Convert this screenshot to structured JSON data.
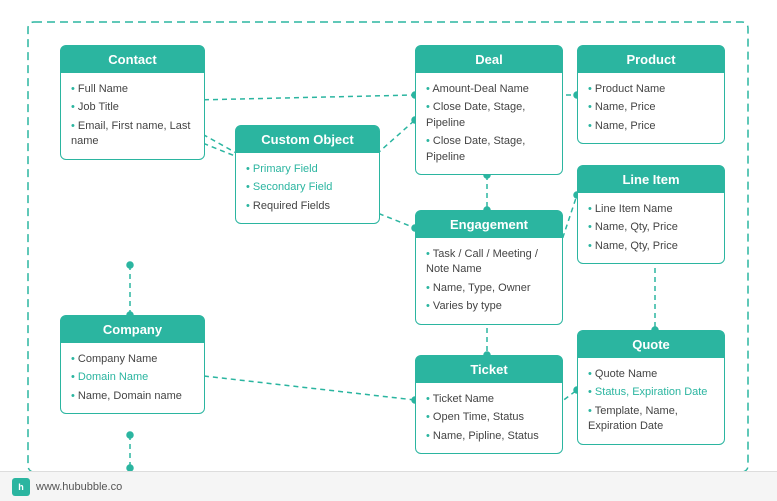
{
  "footer": {
    "logo_text": "h",
    "url": "www.hububble.co"
  },
  "cards": {
    "contact": {
      "title": "Contact",
      "items": [
        {
          "text": "Full Name",
          "style": "normal"
        },
        {
          "text": "Job Title",
          "style": "normal"
        },
        {
          "text": "Email, First name, Last name",
          "style": "normal"
        }
      ]
    },
    "custom_object": {
      "title": "Custom Object",
      "items": [
        {
          "text": "Primary Field",
          "style": "teal"
        },
        {
          "text": "Secondary Field",
          "style": "teal"
        },
        {
          "text": "Required Fields",
          "style": "required"
        }
      ]
    },
    "deal": {
      "title": "Deal",
      "items": [
        {
          "text": "Amount-Deal Name",
          "style": "normal"
        },
        {
          "text": "Close Date, Stage, Pipeline",
          "style": "normal"
        },
        {
          "text": "Close Date, Stage, Pipeline",
          "style": "normal"
        }
      ]
    },
    "product": {
      "title": "Product",
      "items": [
        {
          "text": "Product Name",
          "style": "normal"
        },
        {
          "text": "Name, Price",
          "style": "normal"
        },
        {
          "text": "Name, Price",
          "style": "normal"
        }
      ]
    },
    "engagement": {
      "title": "Engagement",
      "items": [
        {
          "text": "Task / Call / Meeting / Note Name",
          "style": "normal"
        },
        {
          "text": "Name, Type, Owner",
          "style": "normal"
        },
        {
          "text": "Varies by type",
          "style": "normal"
        }
      ]
    },
    "line_item": {
      "title": "Line Item",
      "items": [
        {
          "text": "Line Item Name",
          "style": "normal"
        },
        {
          "text": "Name, Qty, Price",
          "style": "normal"
        },
        {
          "text": "Name, Qty, Price",
          "style": "normal"
        }
      ]
    },
    "company": {
      "title": "Company",
      "items": [
        {
          "text": "Company Name",
          "style": "normal"
        },
        {
          "text": "Domain Name",
          "style": "teal"
        },
        {
          "text": "Name, Domain name",
          "style": "normal"
        }
      ]
    },
    "ticket": {
      "title": "Ticket",
      "items": [
        {
          "text": "Ticket Name",
          "style": "normal"
        },
        {
          "text": "Open Time, Status",
          "style": "normal"
        },
        {
          "text": "Name, Pipline, Status",
          "style": "normal"
        }
      ]
    },
    "quote": {
      "title": "Quote",
      "items": [
        {
          "text": "Quote Name",
          "style": "normal"
        },
        {
          "text": "Status, Expiration Date",
          "style": "teal"
        },
        {
          "text": "Template, Name, Expiration Date",
          "style": "normal"
        }
      ]
    }
  }
}
